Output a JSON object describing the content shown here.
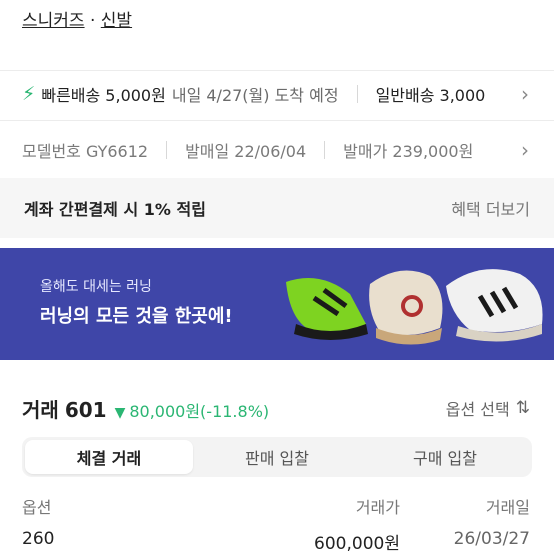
{
  "breadcrumb": {
    "category": "스니커즈",
    "separator": "·",
    "subcategory": "신발"
  },
  "shipping": {
    "fast_icon": "lightning-icon",
    "fast_label": "빠른배송 5,000원",
    "fast_date": "내일 4/27(월) 도착 예정",
    "normal_label": "일반배송 3,000"
  },
  "specs": {
    "model": "모델번호 GY6612",
    "release_date": "발매일 22/06/04",
    "release_price": "발매가 239,000원"
  },
  "promo": {
    "text": "계좌 간편결제 시 1% 적립",
    "link": "혜택 더보기"
  },
  "banner": {
    "subtitle": "올해도 대세는 러닝",
    "title": "러닝의 모든 것을 한곳에!"
  },
  "trades": {
    "title": "거래",
    "count": "601",
    "change_arrow": "▼",
    "change_text": "80,000원(-11.8%)",
    "option_select": "옵션 선택",
    "tabs": [
      "체결 거래",
      "판매 입찰",
      "구매 입찰"
    ],
    "active_tab": "체결 거래",
    "columns": [
      "옵션",
      "거래가",
      "거래일"
    ],
    "rows": [
      {
        "option": "260",
        "price": "600,000원",
        "date": "26/03/27"
      }
    ]
  },
  "colors": {
    "accent_green": "#2bb673",
    "banner_bg": "#3f46a8"
  }
}
